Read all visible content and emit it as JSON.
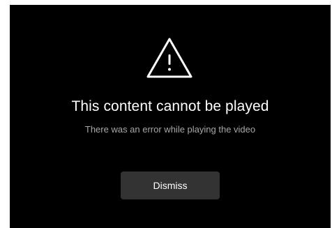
{
  "error_dialog": {
    "icon": "warning-icon",
    "title": "This content cannot be played",
    "message": "There was an error while playing the video",
    "dismiss_label": "Dismiss"
  },
  "colors": {
    "background": "#000000",
    "title": "#ffffff",
    "message": "#a8a8a8",
    "button_bg": "#333333",
    "button_text": "#ffffff"
  }
}
